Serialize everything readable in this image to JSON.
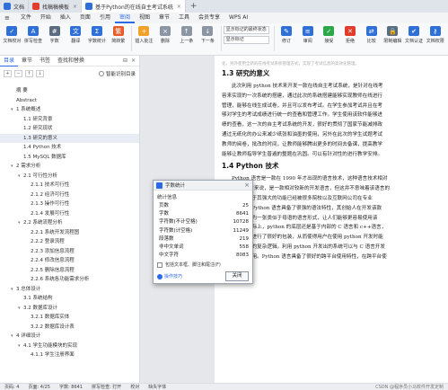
{
  "tabs": [
    {
      "label": "文档",
      "color": "#2f6fd8",
      "active": false,
      "closable": false
    },
    {
      "label": "找稿稿模板",
      "color": "#e23c2d",
      "active": false,
      "closable": true
    },
    {
      "label": "基于Python的在线自主考试系统",
      "color": "#2f6fd8",
      "active": true,
      "closable": true
    }
  ],
  "menu": [
    "文件",
    "开始",
    "插入",
    "页面",
    "引用",
    "审阅",
    "视图",
    "章节",
    "工具",
    "会员专享",
    "WPS AI"
  ],
  "active_menu": "审阅",
  "ribbon": {
    "buttons_left": [
      {
        "label": "文档校对",
        "color": "#2f6fd8",
        "glyph": "✓"
      },
      {
        "label": "拼写检查",
        "color": "#2f6fd8",
        "glyph": "A"
      },
      {
        "label": "字数",
        "color": "#5b6b80",
        "glyph": "#"
      },
      {
        "label": "翻译",
        "color": "#2f6fd8",
        "glyph": "文"
      },
      {
        "label": "字数统计",
        "color": "#2f6fd8",
        "glyph": "Σ"
      },
      {
        "label": "简转繁",
        "color": "#e85b2a",
        "glyph": "繁"
      }
    ],
    "buttons_mid": [
      {
        "label": "插入批注",
        "color": "#f2a12a",
        "glyph": "+"
      },
      {
        "label": "删除",
        "color": "#8b95a3",
        "glyph": "×"
      },
      {
        "label": "上一条",
        "color": "#8b95a3",
        "glyph": "↑"
      },
      {
        "label": "下一条",
        "color": "#8b95a3",
        "glyph": "↓"
      }
    ],
    "combos": [
      "显示标记的最终状态",
      "显示标记"
    ],
    "buttons_right": [
      {
        "label": "修订",
        "color": "#2f6fd8",
        "glyph": "✎"
      },
      {
        "label": "审阅",
        "color": "#2f6fd8",
        "glyph": "≡"
      },
      {
        "label": "接受",
        "color": "#2aa84a",
        "glyph": "✓"
      },
      {
        "label": "拒绝",
        "color": "#e23c2d",
        "glyph": "✕"
      },
      {
        "label": "比较",
        "color": "#2f6fd8",
        "glyph": "⇄"
      },
      {
        "label": "限制编辑",
        "color": "#5b6b80",
        "glyph": "🔒"
      },
      {
        "label": "文档认证",
        "color": "#2f6fd8",
        "glyph": "✔"
      },
      {
        "label": "文档权限",
        "color": "#2f6fd8",
        "glyph": "⚷"
      }
    ]
  },
  "nav": {
    "tabs": [
      "目录",
      "章节",
      "书签",
      "查找和替换"
    ],
    "smart_label": "智能识别目录",
    "outline": [
      {
        "label": "摘  要",
        "level": 0,
        "caret": ""
      },
      {
        "label": "Abstract",
        "level": 0,
        "caret": ""
      },
      {
        "label": "1  系统概述",
        "level": 0,
        "caret": "▾"
      },
      {
        "label": "1.1  研究背景",
        "level": 1,
        "caret": ""
      },
      {
        "label": "1.2  研究现状",
        "level": 1,
        "caret": ""
      },
      {
        "label": "1.3  研究的意义",
        "level": 1,
        "caret": "",
        "selected": true
      },
      {
        "label": "1.4 Python 技术",
        "level": 1,
        "caret": ""
      },
      {
        "label": "1.5 MySQL 数据库",
        "level": 1,
        "caret": ""
      },
      {
        "label": "2  需求分析",
        "level": 0,
        "caret": "▾"
      },
      {
        "label": "2.1  可行性分析",
        "level": 1,
        "caret": "▾"
      },
      {
        "label": "2.1.1  技术可行性",
        "level": 2,
        "caret": ""
      },
      {
        "label": "2.1.2  经济可行性",
        "level": 2,
        "caret": ""
      },
      {
        "label": "2.1.3  操作可行性",
        "level": 2,
        "caret": ""
      },
      {
        "label": "2.1.4  发展可行性",
        "level": 2,
        "caret": ""
      },
      {
        "label": "2.2  系统流程分析",
        "level": 1,
        "caret": "▾"
      },
      {
        "label": "2.2.1  系统开发流程图",
        "level": 2,
        "caret": ""
      },
      {
        "label": "2.2.2  登录流程",
        "level": 2,
        "caret": ""
      },
      {
        "label": "2.2.3  添加信息流程",
        "level": 2,
        "caret": ""
      },
      {
        "label": "2.2.4  修改信息流程",
        "level": 2,
        "caret": ""
      },
      {
        "label": "2.2.5  删除信息流程",
        "level": 2,
        "caret": ""
      },
      {
        "label": "2.2.6  系统各功能需求分析",
        "level": 2,
        "caret": ""
      },
      {
        "label": "3  总体设计",
        "level": 0,
        "caret": "▾"
      },
      {
        "label": "3.1  系统结构",
        "level": 1,
        "caret": ""
      },
      {
        "label": "3.2  数据库设计",
        "level": 1,
        "caret": "▾"
      },
      {
        "label": "3.2.1  数据库实体",
        "level": 2,
        "caret": ""
      },
      {
        "label": "3.2.2  数据库设计表",
        "level": 2,
        "caret": ""
      },
      {
        "label": "4  详细设计",
        "level": 0,
        "caret": "▾"
      },
      {
        "label": "4.1  学生功能模块的实现",
        "level": 1,
        "caret": "▾"
      },
      {
        "label": "4.1.1  学生注册界面",
        "level": 2,
        "caret": ""
      }
    ]
  },
  "document": {
    "line_number": "1",
    "top_cut": "化，另外使用全新的在线考试系统管理方式，实现了考试信息的高效化管理。",
    "h1": "1.3   研究的意义",
    "para1": [
      "此次利用 python 技术来开发一款在线自主考试系统，是针对在线考",
      "容来实现的一次系统的搭建，通过此次的系统搭建能够实现教师在线进行",
      "管理，能够在线生成试卷，并且可以发布考试。在学生参加考试并且在考",
      "够对学生的考试成绩进行统一的查看和管理工作。学生使用该软件能够进",
      "绩的查看，这一次的自主考试系统的开发，很好的贯彻了国家节能减排政",
      "通过无纸化的办公来减少纸张和油墨的使用，另外在此次的学生试题考试",
      "教师的阅卷，批改的时间，让教师能够腾出更多的时间去备课，提高教学",
      "能够让教师指导学生普遍的整题在巩固。可以有针对性的进行教学安排。"
    ],
    "h2": "1.4 Python 技术",
    "para2": [
      "Python 语言是一款在 1990 年才出现的语言技术，这种语言技术相对",
      "C++语言而言来说，是一款相对较新的开发语言，但这并不意味着该语言的",
      "相反该语言由于其强大的功能已经被很多院校以及互联网公司在专业",
      "的基础语言，Python 语言具备了很强的语法特性，其创始人在开发该款",
      "该语言能够成为一张类似于母语的语言形式，让人们能够更容易使用该",
      "序的编写。实际上，python 的底层还是基于内部的 C 语言和 c++语言，",
      "该类底层语言进行了很好的包装，从而使得用户在使用 python 开发时能",
      "底层语言背后的复杂逻辑。利用 python 开发出的系统可以与 C 语言开发",
      "良好的对接使用。Python 语言具备了很好的跨平台使用特性，在跨平台使"
    ]
  },
  "dialog": {
    "title": "字数统计",
    "section": "统计信息",
    "stats": [
      {
        "label": "页数",
        "value": "25"
      },
      {
        "label": "字数",
        "value": "8641"
      },
      {
        "label": "字符数(不计空格)",
        "value": "10728"
      },
      {
        "label": "字符数(计空格)",
        "value": "11249"
      },
      {
        "label": "段落数",
        "value": "219"
      },
      {
        "label": "非中文单词",
        "value": "558"
      },
      {
        "label": "中文字符",
        "value": "8083"
      }
    ],
    "checkbox_label": "包括文本框、脚注和尾注(F)",
    "skill_label": "操作技巧",
    "close_label": "关闭"
  },
  "status": {
    "page": "页码: 4",
    "pages": "页面: 4/25",
    "words": "字数: 8641",
    "spell": "拼写检查: 打开",
    "proof": "校对",
    "font_missing": "缺失字体",
    "watermark": "CSDN @程序员小马软件开发定制"
  }
}
